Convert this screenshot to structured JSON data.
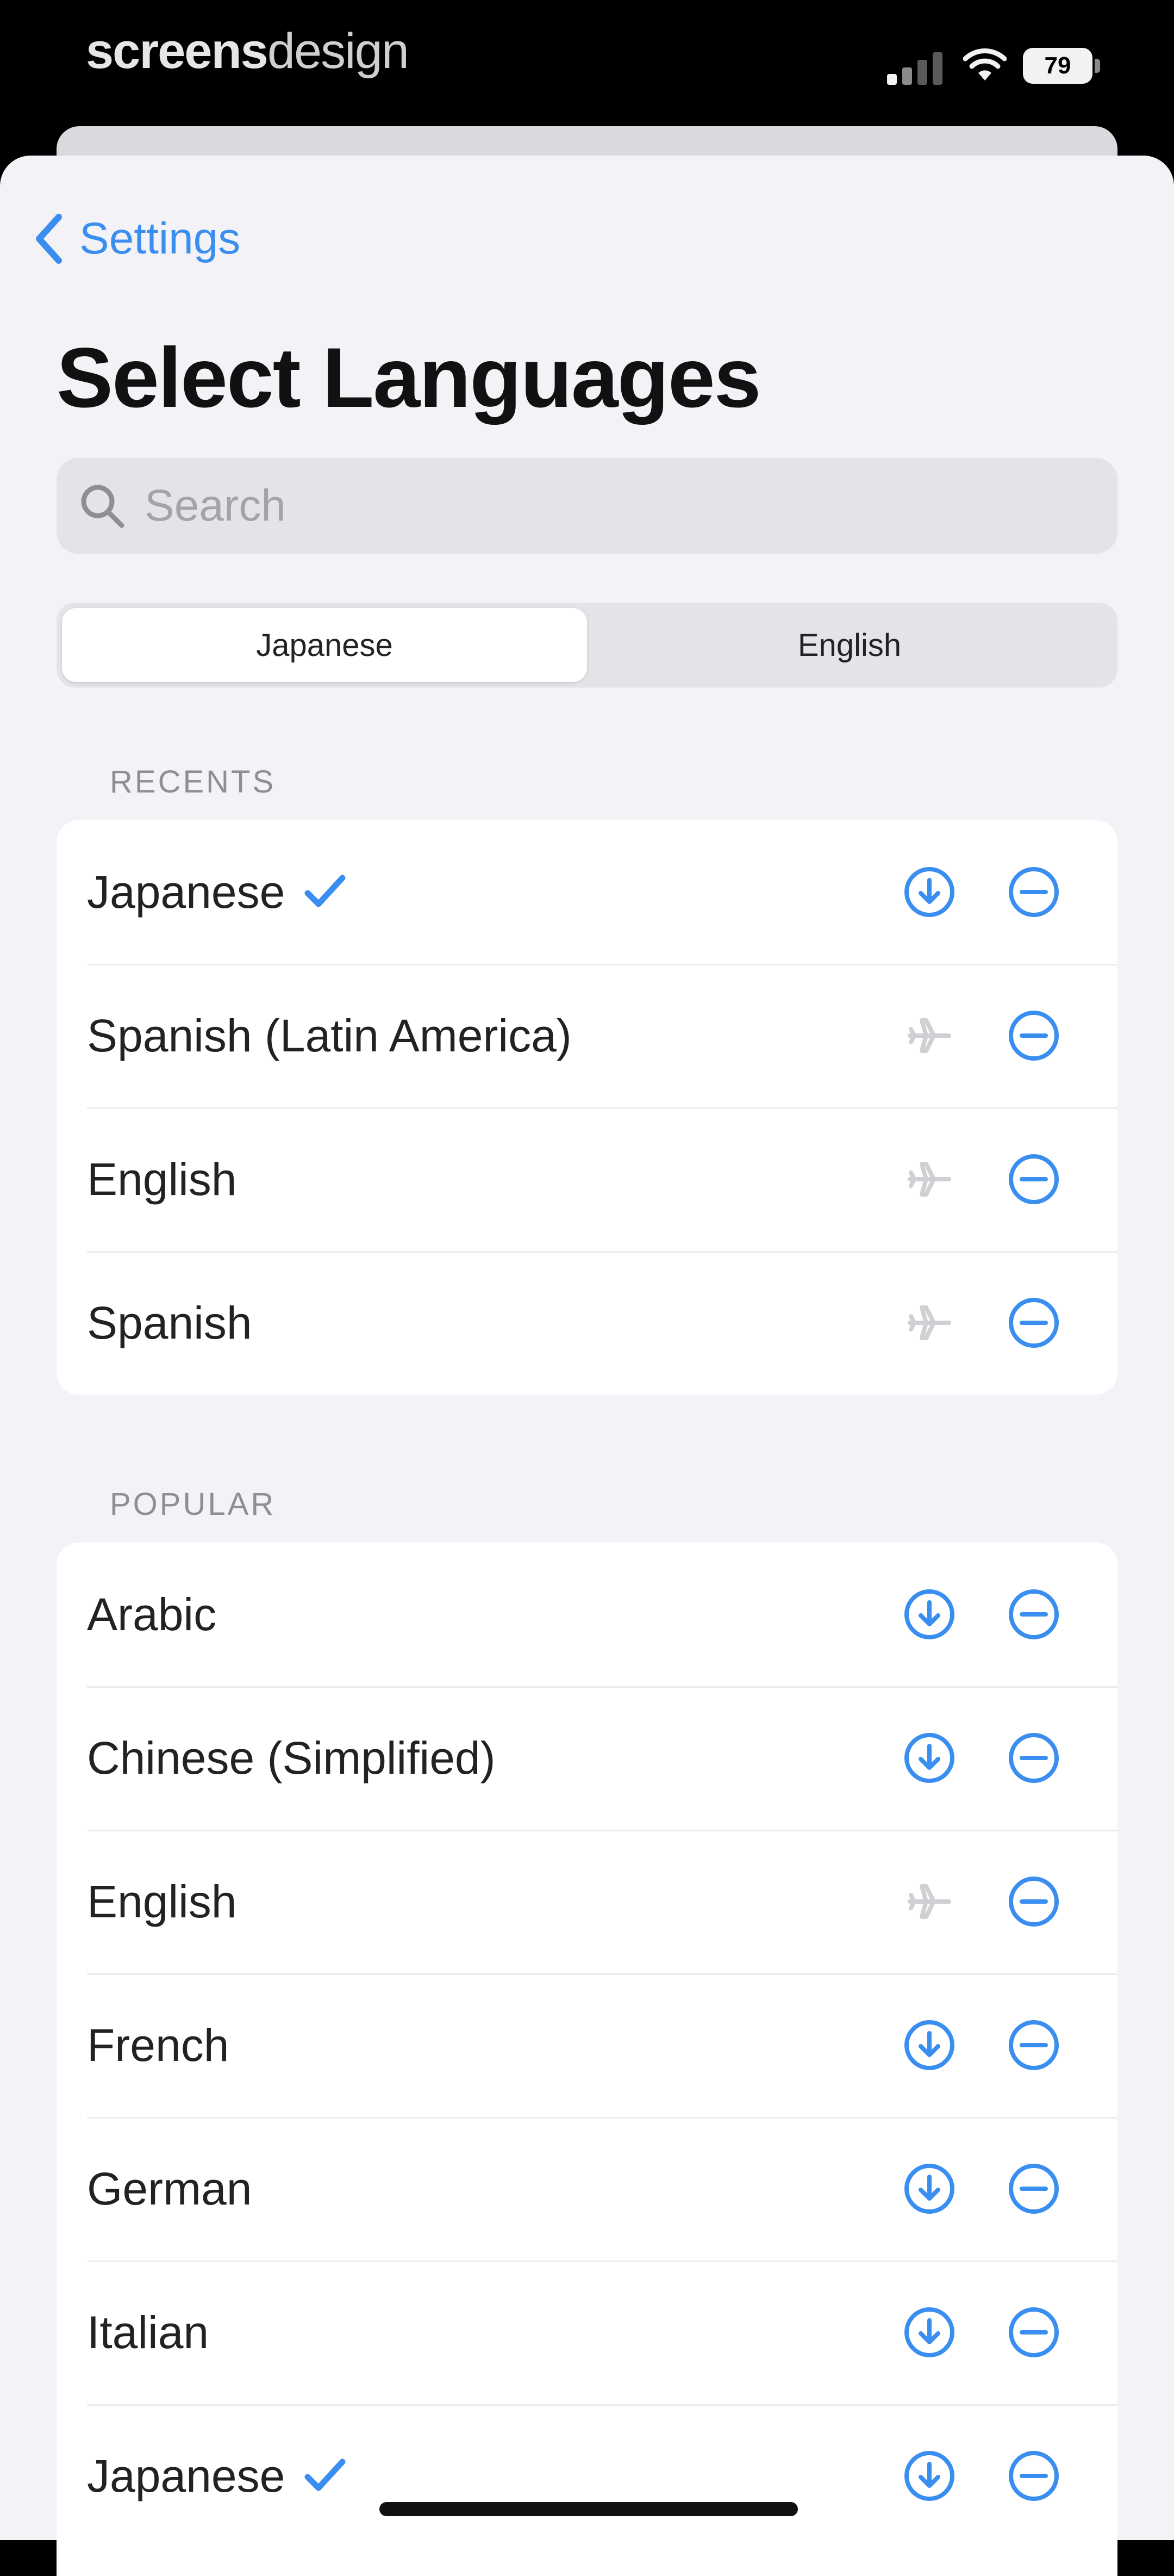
{
  "status_bar": {
    "brand_bold": "screens",
    "brand_light": "design",
    "battery": "79"
  },
  "nav": {
    "back_label": "Settings"
  },
  "page_title": "Select Languages",
  "search": {
    "placeholder": "Search"
  },
  "segmented": {
    "options": [
      "Japanese",
      "English"
    ],
    "selected_index": 0
  },
  "sections": [
    {
      "header": "RECENTS",
      "rows": [
        {
          "label": "Japanese",
          "checked": true,
          "download": "available"
        },
        {
          "label": "Spanish (Latin America)",
          "checked": false,
          "download": "offline"
        },
        {
          "label": "English",
          "checked": false,
          "download": "offline"
        },
        {
          "label": "Spanish",
          "checked": false,
          "download": "offline"
        }
      ]
    },
    {
      "header": "POPULAR",
      "rows": [
        {
          "label": "Arabic",
          "checked": false,
          "download": "available"
        },
        {
          "label": "Chinese (Simplified)",
          "checked": false,
          "download": "available"
        },
        {
          "label": "English",
          "checked": false,
          "download": "offline"
        },
        {
          "label": "French",
          "checked": false,
          "download": "available"
        },
        {
          "label": "German",
          "checked": false,
          "download": "available"
        },
        {
          "label": "Italian",
          "checked": false,
          "download": "available"
        },
        {
          "label": "Japanese",
          "checked": true,
          "download": "available"
        }
      ]
    }
  ],
  "colors": {
    "accent": "#3a8ef0",
    "background": "#f2f2f7",
    "muted_icon": "#cfcfd4"
  }
}
